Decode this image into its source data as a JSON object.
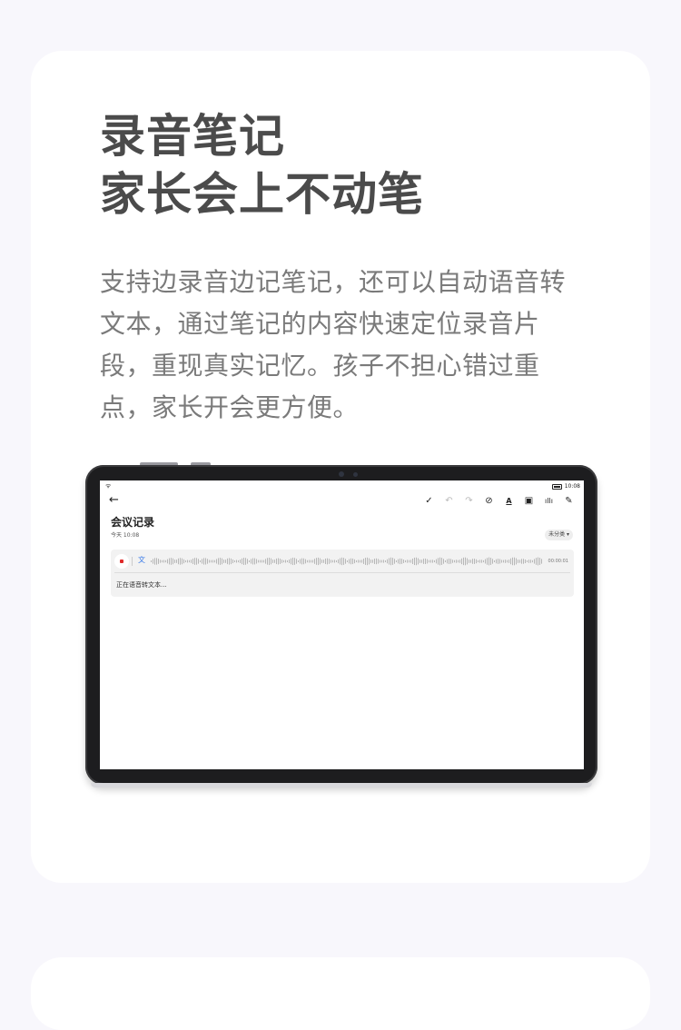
{
  "headline": {
    "line1": "录音笔记",
    "line2": "家长会上不动笔"
  },
  "description": "支持边录音边记笔记，还可以自动语音转文本，通过笔记的内容快速定位录音片段，重现真实记忆。孩子不担心错过重点，家长开会更方便。",
  "tablet": {
    "status_time": "10:08",
    "toolbar_icons": [
      "check-icon",
      "undo-icon",
      "redo-icon",
      "checklist-icon",
      "text-style-icon",
      "image-icon",
      "audio-icon",
      "pen-icon"
    ],
    "note": {
      "title": "会议记录",
      "date": "今天 10:08",
      "category": "未分类 ▾",
      "recording": {
        "duration": "00:00:01",
        "status": "正在语音转文本..."
      }
    }
  },
  "colors": {
    "page_bg": "#f8f7fc",
    "card_bg": "#ffffff",
    "headline": "#4b4b4b",
    "body_text": "#7a7a7a",
    "record_red": "#e02a2a",
    "accent_blue": "#3a7be8"
  }
}
